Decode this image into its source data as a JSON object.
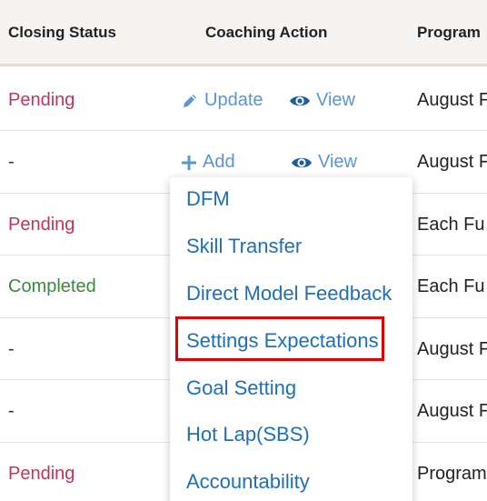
{
  "table": {
    "headers": {
      "closing_status": "Closing Status",
      "coaching_action": "Coaching Action",
      "program": "Program"
    },
    "rows": [
      {
        "status": "Pending",
        "action1": "Update",
        "action2": "View",
        "program": "August F"
      },
      {
        "status": "-",
        "action1": "Add",
        "action2": "View",
        "program": "August F"
      },
      {
        "status": "Pending",
        "program": "Each Fu"
      },
      {
        "status": "Completed",
        "program": "Each Fu"
      },
      {
        "status": "-",
        "program": "August F"
      },
      {
        "status": "-",
        "program": "August F"
      },
      {
        "status": "Pending",
        "program": "Program"
      }
    ]
  },
  "dropdown": {
    "items": [
      "DFM",
      "Skill Transfer",
      "Direct Model Feedback",
      "Settings Expectations",
      "Goal Setting",
      "Hot Lap(SBS)",
      "Accountability"
    ],
    "highlighted_item": "Settings Expectations"
  },
  "colors": {
    "pending": "#c0365a",
    "completed": "#3a8a3a",
    "link": "#5a95d6",
    "dropdown_link": "#1e6fb5",
    "highlight_border": "#e00000",
    "header_bg": "#f6f4f2"
  },
  "icons": {
    "update": "pencil-icon",
    "view": "eye-icon",
    "add": "plus-icon"
  }
}
